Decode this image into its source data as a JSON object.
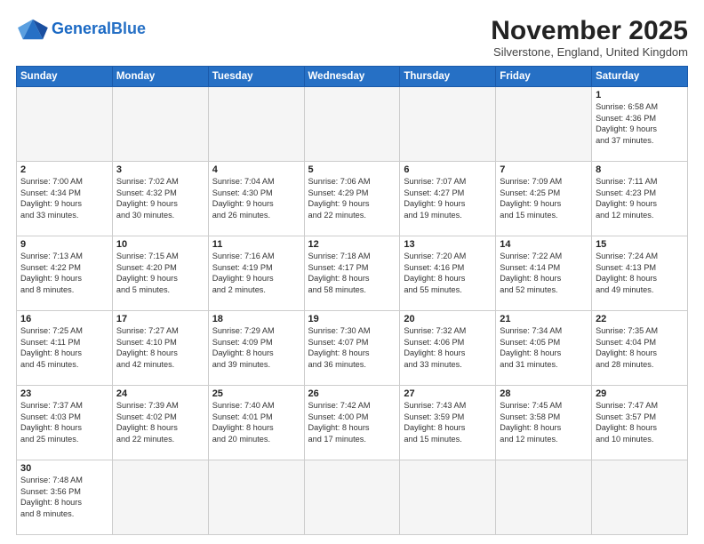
{
  "header": {
    "logo_general": "General",
    "logo_blue": "Blue",
    "month_title": "November 2025",
    "subtitle": "Silverstone, England, United Kingdom"
  },
  "weekdays": [
    "Sunday",
    "Monday",
    "Tuesday",
    "Wednesday",
    "Thursday",
    "Friday",
    "Saturday"
  ],
  "weeks": [
    [
      {
        "day": "",
        "info": "",
        "empty": true
      },
      {
        "day": "",
        "info": "",
        "empty": true
      },
      {
        "day": "",
        "info": "",
        "empty": true
      },
      {
        "day": "",
        "info": "",
        "empty": true
      },
      {
        "day": "",
        "info": "",
        "empty": true
      },
      {
        "day": "",
        "info": "",
        "empty": true
      },
      {
        "day": "1",
        "info": "Sunrise: 6:58 AM\nSunset: 4:36 PM\nDaylight: 9 hours\nand 37 minutes.",
        "empty": false
      }
    ],
    [
      {
        "day": "2",
        "info": "Sunrise: 7:00 AM\nSunset: 4:34 PM\nDaylight: 9 hours\nand 33 minutes.",
        "empty": false
      },
      {
        "day": "3",
        "info": "Sunrise: 7:02 AM\nSunset: 4:32 PM\nDaylight: 9 hours\nand 30 minutes.",
        "empty": false
      },
      {
        "day": "4",
        "info": "Sunrise: 7:04 AM\nSunset: 4:30 PM\nDaylight: 9 hours\nand 26 minutes.",
        "empty": false
      },
      {
        "day": "5",
        "info": "Sunrise: 7:06 AM\nSunset: 4:29 PM\nDaylight: 9 hours\nand 22 minutes.",
        "empty": false
      },
      {
        "day": "6",
        "info": "Sunrise: 7:07 AM\nSunset: 4:27 PM\nDaylight: 9 hours\nand 19 minutes.",
        "empty": false
      },
      {
        "day": "7",
        "info": "Sunrise: 7:09 AM\nSunset: 4:25 PM\nDaylight: 9 hours\nand 15 minutes.",
        "empty": false
      },
      {
        "day": "8",
        "info": "Sunrise: 7:11 AM\nSunset: 4:23 PM\nDaylight: 9 hours\nand 12 minutes.",
        "empty": false
      }
    ],
    [
      {
        "day": "9",
        "info": "Sunrise: 7:13 AM\nSunset: 4:22 PM\nDaylight: 9 hours\nand 8 minutes.",
        "empty": false
      },
      {
        "day": "10",
        "info": "Sunrise: 7:15 AM\nSunset: 4:20 PM\nDaylight: 9 hours\nand 5 minutes.",
        "empty": false
      },
      {
        "day": "11",
        "info": "Sunrise: 7:16 AM\nSunset: 4:19 PM\nDaylight: 9 hours\nand 2 minutes.",
        "empty": false
      },
      {
        "day": "12",
        "info": "Sunrise: 7:18 AM\nSunset: 4:17 PM\nDaylight: 8 hours\nand 58 minutes.",
        "empty": false
      },
      {
        "day": "13",
        "info": "Sunrise: 7:20 AM\nSunset: 4:16 PM\nDaylight: 8 hours\nand 55 minutes.",
        "empty": false
      },
      {
        "day": "14",
        "info": "Sunrise: 7:22 AM\nSunset: 4:14 PM\nDaylight: 8 hours\nand 52 minutes.",
        "empty": false
      },
      {
        "day": "15",
        "info": "Sunrise: 7:24 AM\nSunset: 4:13 PM\nDaylight: 8 hours\nand 49 minutes.",
        "empty": false
      }
    ],
    [
      {
        "day": "16",
        "info": "Sunrise: 7:25 AM\nSunset: 4:11 PM\nDaylight: 8 hours\nand 45 minutes.",
        "empty": false
      },
      {
        "day": "17",
        "info": "Sunrise: 7:27 AM\nSunset: 4:10 PM\nDaylight: 8 hours\nand 42 minutes.",
        "empty": false
      },
      {
        "day": "18",
        "info": "Sunrise: 7:29 AM\nSunset: 4:09 PM\nDaylight: 8 hours\nand 39 minutes.",
        "empty": false
      },
      {
        "day": "19",
        "info": "Sunrise: 7:30 AM\nSunset: 4:07 PM\nDaylight: 8 hours\nand 36 minutes.",
        "empty": false
      },
      {
        "day": "20",
        "info": "Sunrise: 7:32 AM\nSunset: 4:06 PM\nDaylight: 8 hours\nand 33 minutes.",
        "empty": false
      },
      {
        "day": "21",
        "info": "Sunrise: 7:34 AM\nSunset: 4:05 PM\nDaylight: 8 hours\nand 31 minutes.",
        "empty": false
      },
      {
        "day": "22",
        "info": "Sunrise: 7:35 AM\nSunset: 4:04 PM\nDaylight: 8 hours\nand 28 minutes.",
        "empty": false
      }
    ],
    [
      {
        "day": "23",
        "info": "Sunrise: 7:37 AM\nSunset: 4:03 PM\nDaylight: 8 hours\nand 25 minutes.",
        "empty": false
      },
      {
        "day": "24",
        "info": "Sunrise: 7:39 AM\nSunset: 4:02 PM\nDaylight: 8 hours\nand 22 minutes.",
        "empty": false
      },
      {
        "day": "25",
        "info": "Sunrise: 7:40 AM\nSunset: 4:01 PM\nDaylight: 8 hours\nand 20 minutes.",
        "empty": false
      },
      {
        "day": "26",
        "info": "Sunrise: 7:42 AM\nSunset: 4:00 PM\nDaylight: 8 hours\nand 17 minutes.",
        "empty": false
      },
      {
        "day": "27",
        "info": "Sunrise: 7:43 AM\nSunset: 3:59 PM\nDaylight: 8 hours\nand 15 minutes.",
        "empty": false
      },
      {
        "day": "28",
        "info": "Sunrise: 7:45 AM\nSunset: 3:58 PM\nDaylight: 8 hours\nand 12 minutes.",
        "empty": false
      },
      {
        "day": "29",
        "info": "Sunrise: 7:47 AM\nSunset: 3:57 PM\nDaylight: 8 hours\nand 10 minutes.",
        "empty": false
      }
    ],
    [
      {
        "day": "30",
        "info": "Sunrise: 7:48 AM\nSunset: 3:56 PM\nDaylight: 8 hours\nand 8 minutes.",
        "empty": false
      },
      {
        "day": "",
        "info": "",
        "empty": true
      },
      {
        "day": "",
        "info": "",
        "empty": true
      },
      {
        "day": "",
        "info": "",
        "empty": true
      },
      {
        "day": "",
        "info": "",
        "empty": true
      },
      {
        "day": "",
        "info": "",
        "empty": true
      },
      {
        "day": "",
        "info": "",
        "empty": true
      }
    ]
  ]
}
